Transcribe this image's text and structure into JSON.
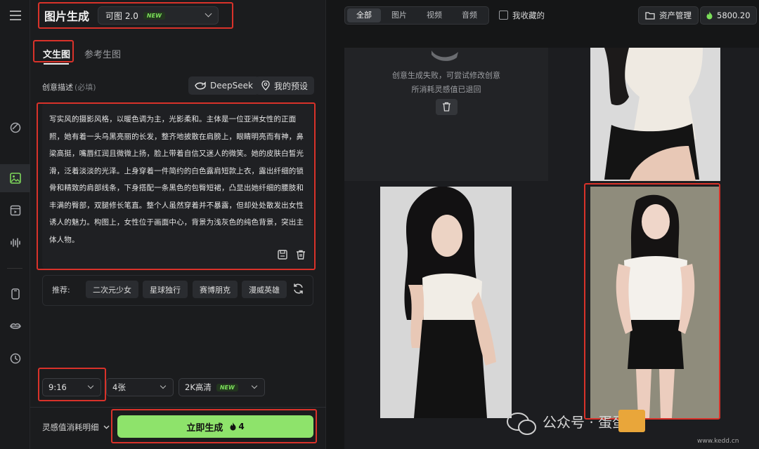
{
  "app": {
    "title": "图片生成",
    "model_name": "可图 2.0",
    "model_badge": "NEW"
  },
  "tabs": [
    {
      "label": "文生图",
      "active": true
    },
    {
      "label": "参考生图",
      "active": false
    }
  ],
  "prompt_section": {
    "label": "创意描述",
    "required_hint": "(必填)",
    "deepseek_label": "DeepSeek",
    "presets_label": "我的预设",
    "text": "写实风的摄影风格，以暖色调为主，光影柔和。主体是一位亚洲女性的正面照，她有着一头乌黑亮丽的长发，整齐地披散在肩膀上，眼睛明亮而有神，鼻梁高挺，嘴唇红润且微微上扬，脸上带着自信又迷人的微笑。她的皮肤白皙光滑，泛着淡淡的光泽。上身穿着一件简约的白色露肩短款上衣，露出纤细的锁骨和精致的肩部线条，下身搭配一条黑色的包臀短裙，凸显出她纤细的腰肢和丰满的臀部，双腿修长笔直。整个人虽然穿着并不暴露，但却处处散发出女性诱人的魅力。构图上，女性位于画面中心，背景为浅灰色的纯色背景，突出主体人物。"
  },
  "recommend": {
    "label": "推荐:",
    "chips": [
      "二次元少女",
      "星球独行",
      "赛博朋克",
      "漫威英雄"
    ]
  },
  "settings": {
    "ratio": "9:16",
    "count": "4张",
    "quality": "2K高清",
    "quality_badge": "NEW"
  },
  "footer": {
    "cost_label": "灵感值消耗明细",
    "generate_label": "立即生成",
    "generate_cost": "4"
  },
  "right_header": {
    "filters": [
      "全部",
      "图片",
      "视频",
      "音频"
    ],
    "active_filter": "全部",
    "favorites_label": "我收藏的",
    "assets_label": "资产管理",
    "balance": "5800.20"
  },
  "gallery": {
    "fail_line1": "创意生成失败，可尝试修改创意",
    "fail_line2": "所消耗灵感值已退回"
  },
  "watermark": {
    "text": "公众号 · 蛋蛋",
    "site": "www.kedd.cn"
  },
  "colors": {
    "accent_green": "#8ee36b",
    "highlight_red": "#d9322a",
    "background": "#151617"
  }
}
